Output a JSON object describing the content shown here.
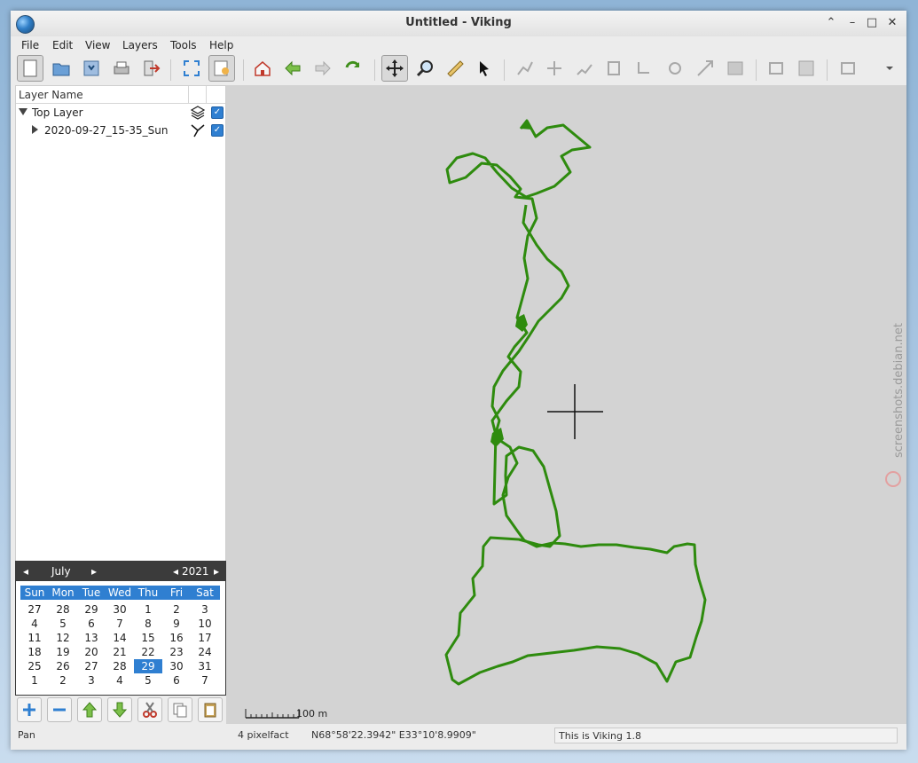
{
  "window": {
    "title": "Untitled - Viking"
  },
  "menu": [
    "File",
    "Edit",
    "View",
    "Layers",
    "Tools",
    "Help"
  ],
  "layers_panel": {
    "header": "Layer Name",
    "rows": [
      {
        "name": "Top Layer",
        "checked": true,
        "icon": "layers-icon"
      },
      {
        "name": "2020-09-27_15-35_Sun",
        "checked": true,
        "icon": "track-icon"
      }
    ]
  },
  "calendar": {
    "month": "July",
    "year": "2021",
    "day_names": [
      "Sun",
      "Mon",
      "Tue",
      "Wed",
      "Thu",
      "Fri",
      "Sat"
    ],
    "weeks": [
      [
        "27",
        "28",
        "29",
        "30",
        "1",
        "2",
        "3"
      ],
      [
        "4",
        "5",
        "6",
        "7",
        "8",
        "9",
        "10"
      ],
      [
        "11",
        "12",
        "13",
        "14",
        "15",
        "16",
        "17"
      ],
      [
        "18",
        "19",
        "20",
        "21",
        "22",
        "23",
        "24"
      ],
      [
        "25",
        "26",
        "27",
        "28",
        "29",
        "30",
        "31"
      ],
      [
        "1",
        "2",
        "3",
        "4",
        "5",
        "6",
        "7"
      ]
    ],
    "selected_day": "29"
  },
  "map": {
    "scale_label": "100 m",
    "track_color": "#2e8b0e",
    "watermark": "screenshots.debian.net"
  },
  "status": {
    "mode": "Pan",
    "zoom": "4 pixelfact",
    "position": "N68°58'22.3942\" E33°10'8.9909\"",
    "message": "This is Viking 1.8"
  }
}
